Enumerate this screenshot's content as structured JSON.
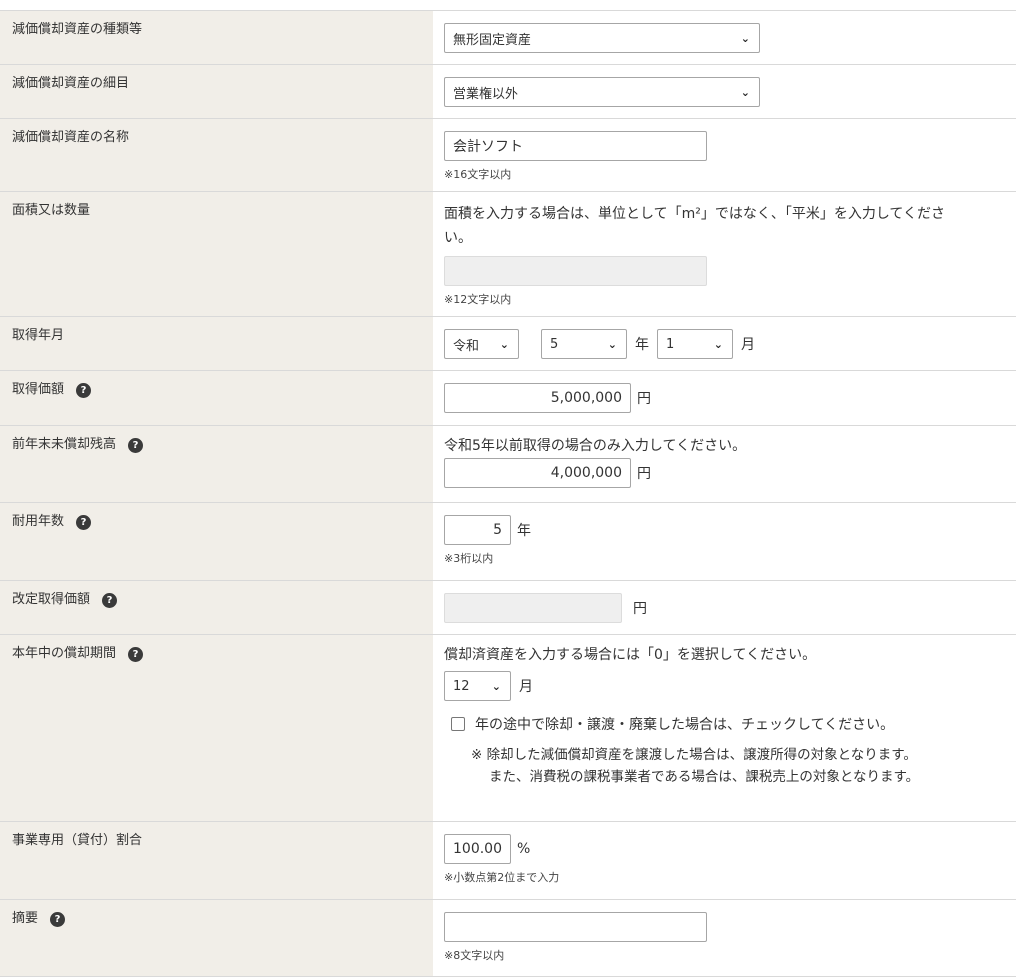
{
  "rows": {
    "asset_type": {
      "label": "減価償却資産の種類等",
      "value": "無形固定資産"
    },
    "asset_detail": {
      "label": "減価償却資産の細目",
      "value": "営業権以外"
    },
    "asset_name": {
      "label": "減価償却資産の名称",
      "value": "会計ソフト",
      "note": "※16文字以内"
    },
    "area": {
      "label": "面積又は数量",
      "desc": "面積を入力する場合は、単位として「m²」ではなく、「平米」を入力してください。",
      "desc_line1": "面積を入力する場合は、単位として「m²」ではなく、「平米」を入力してくださ",
      "desc_line2": "い。",
      "value": "",
      "note": "※12文字以内"
    },
    "acq_date": {
      "label": "取得年月",
      "era": "令和",
      "year": "5",
      "year_unit": "年",
      "month": "1",
      "month_unit": "月"
    },
    "acq_price": {
      "label": "取得価額",
      "help": "?",
      "value": "5,000,000",
      "unit": "円"
    },
    "prev_balance": {
      "label": "前年末未償却残高",
      "help": "?",
      "desc": "令和5年以前取得の場合のみ入力してください。",
      "value": "4,000,000",
      "unit": "円"
    },
    "useful_life": {
      "label": "耐用年数",
      "help": "?",
      "value": "5",
      "unit": "年",
      "note": "※3桁以内"
    },
    "revised_price": {
      "label": "改定取得価額",
      "help": "?",
      "value": "",
      "unit": "円"
    },
    "period": {
      "label": "本年中の償却期間",
      "help": "?",
      "desc": "償却済資産を入力する場合には「0」を選択してください。",
      "months": "12",
      "unit": "月",
      "checkbox_label": "年の途中で除却・譲渡・廃棄した場合は、チェックしてください。",
      "note_line1": "※ 除却した減価償却資産を譲渡した場合は、譲渡所得の対象となります。",
      "note_line2": "また、消費税の課税事業者である場合は、課税売上の対象となります。"
    },
    "business_ratio": {
      "label": "事業専用（貸付）割合",
      "value": "100.00",
      "unit": "%",
      "note": "※小数点第2位まで入力"
    },
    "summary": {
      "label": "摘要",
      "help": "?",
      "value": "",
      "note": "※8文字以内"
    }
  },
  "icons": {
    "help": "question-circle-icon",
    "dropdown": "chevron-down-icon"
  }
}
